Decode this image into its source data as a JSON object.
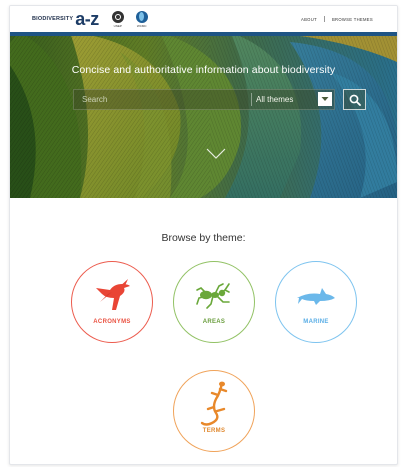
{
  "header": {
    "brand_word": "BIODIVERSITY",
    "brand_az": "a-z",
    "logos": [
      {
        "icon": "unep-logo-icon",
        "label": "UNEP"
      },
      {
        "icon": "wcmc-logo-icon",
        "label": "WCMC"
      }
    ],
    "nav": {
      "about_label": "ABOUT",
      "browse_label": "BROWSE THEMES"
    }
  },
  "hero": {
    "title": "Concise and authoritative information about biodiversity",
    "search": {
      "placeholder": "Search",
      "theme_selected": "All themes",
      "dropdown_icon": "chevron-down-icon",
      "button_icon": "search-icon"
    },
    "scroll_icon": "chevron-down-icon"
  },
  "browse": {
    "title": "Browse by theme:",
    "themes": [
      {
        "label": "ACRONYMS",
        "icon": "hummingbird-icon",
        "color": "#ec5c4e"
      },
      {
        "label": "AREAS",
        "icon": "ant-icon",
        "color": "#92c265"
      },
      {
        "label": "MARINE",
        "icon": "shark-icon",
        "color": "#7ec4ef"
      },
      {
        "label": "TERMS",
        "icon": "lizard-icon",
        "color": "#f0a35a"
      }
    ]
  },
  "colors": {
    "brand_navy": "#1d3c66",
    "hero_bar": "#1e5484"
  }
}
